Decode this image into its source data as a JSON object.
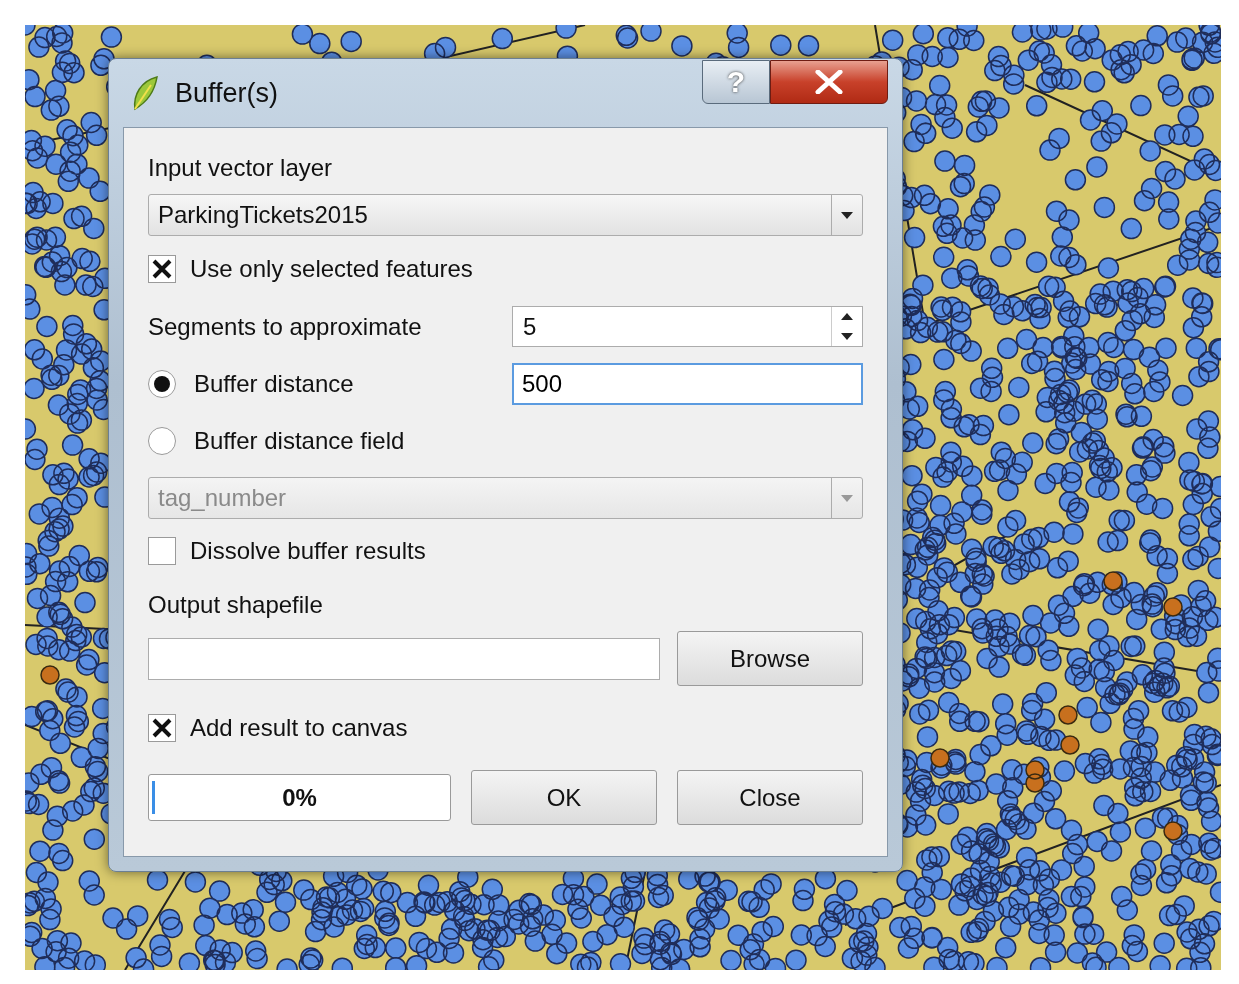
{
  "window": {
    "title": "Buffer(s)",
    "help": "?"
  },
  "input_layer": {
    "label": "Input vector layer",
    "value": "ParkingTickets2015"
  },
  "use_selected": {
    "label": "Use only selected features",
    "checked": true
  },
  "segments": {
    "label": "Segments to approximate",
    "value": "5"
  },
  "distance_options": [
    {
      "label": "Buffer distance",
      "selected": true,
      "value": "500"
    },
    {
      "label": "Buffer distance field",
      "selected": false
    }
  ],
  "distance_field": {
    "value": "tag_number",
    "disabled": true
  },
  "dissolve": {
    "label": "Dissolve buffer results",
    "checked": false
  },
  "output": {
    "label": "Output shapefile",
    "browse": "Browse"
  },
  "add_to_canvas": {
    "label": "Add result to canvas",
    "checked": true
  },
  "progress": {
    "level": 0,
    "text": "0%"
  },
  "buttons": [
    "OK",
    "Close"
  ]
}
